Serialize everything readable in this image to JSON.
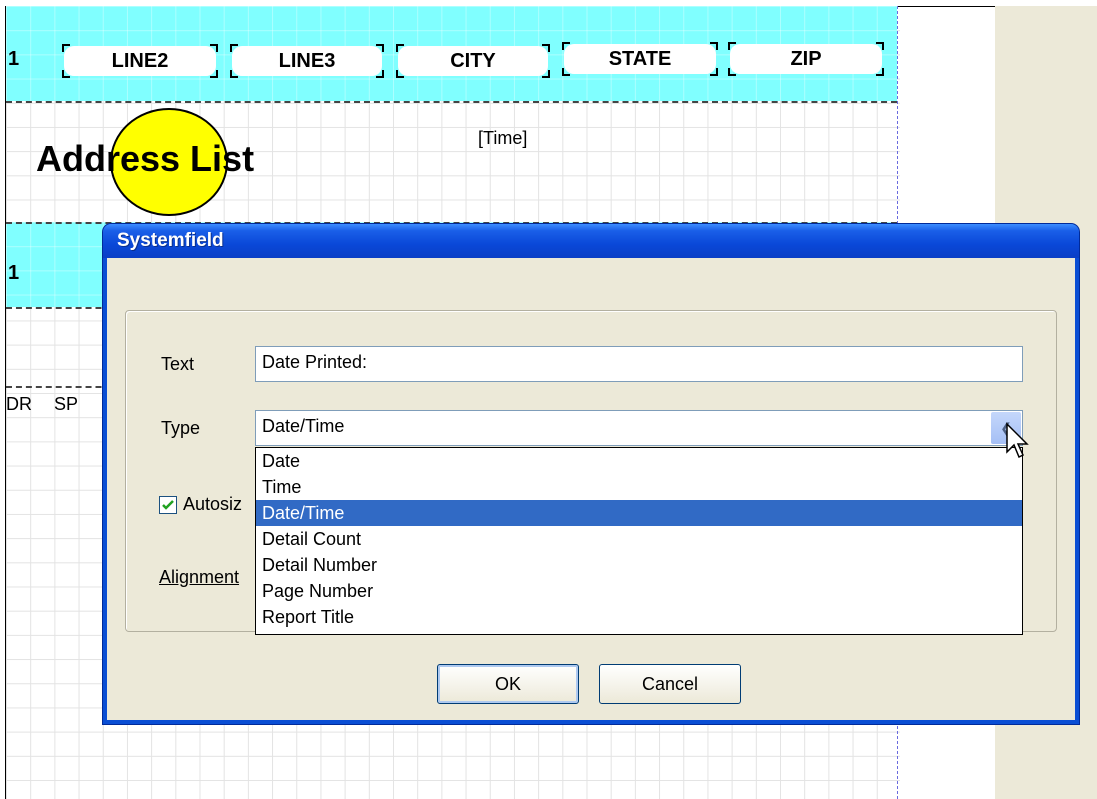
{
  "report": {
    "header_fields": [
      "1",
      "LINE2",
      "LINE3",
      "CITY",
      "STATE",
      "ZIP"
    ],
    "title": "Address List",
    "time_field": "[Time]",
    "detail_partial_1": "1",
    "detail_partial_2": "DR",
    "detail_partial_3": "SP"
  },
  "dialog": {
    "title": "Systemfield",
    "text_label": "Text",
    "text_value": "Date Printed:",
    "type_label": "Type",
    "type_value": "Date/Time",
    "type_options": [
      "Date",
      "Time",
      "Date/Time",
      "Detail Count",
      "Detail Number",
      "Page Number",
      "Report Title"
    ],
    "type_selected_index": 2,
    "autosize_label": "Autosiz",
    "autosize_checked": true,
    "alignment_label": "Alignment",
    "ok_label": "OK",
    "cancel_label": "Cancel"
  },
  "colors": {
    "band": "#80ffff",
    "title_bar": "#0a48d8",
    "selection": "#316ac5",
    "ellipse": "#ffff00"
  }
}
